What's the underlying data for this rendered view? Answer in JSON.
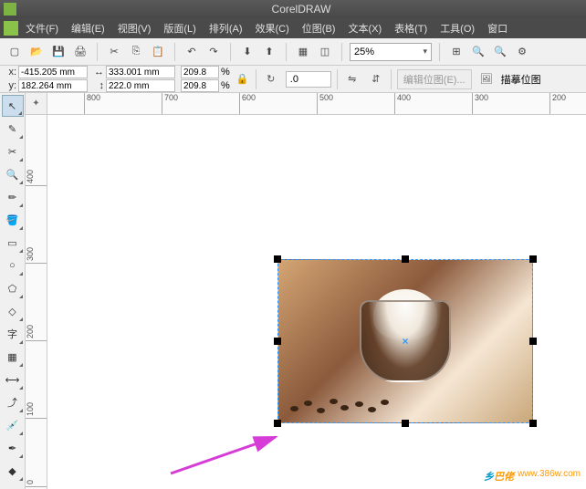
{
  "app": {
    "title": "CorelDRAW"
  },
  "menu": {
    "file": "文件(F)",
    "edit": "编辑(E)",
    "view": "视图(V)",
    "layout": "版面(L)",
    "arrange": "排列(A)",
    "effects": "效果(C)",
    "bitmaps": "位图(B)",
    "text": "文本(X)",
    "table": "表格(T)",
    "tools": "工具(O)",
    "window": "窗口"
  },
  "toolbar": {
    "zoom": "25%"
  },
  "propbar": {
    "x_label": "x:",
    "y_label": "y:",
    "x_value": "-415.205 mm",
    "y_value": "182.264 mm",
    "w_value": "333.001 mm",
    "h_value": "222.0 mm",
    "scale_x": "209.8",
    "scale_y": "209.8",
    "pct": "%",
    "angle": ".0",
    "edit_bitmap": "编辑位图(E)...",
    "trace_bitmap": "描摹位图"
  },
  "ruler_h": {
    "t800": "800",
    "t700": "700",
    "t600": "600",
    "t500": "500",
    "t400": "400",
    "t300": "300",
    "t200": "200"
  },
  "ruler_v": {
    "t400": "400",
    "t300": "300",
    "t200": "200",
    "t100": "100",
    "t0": "0"
  },
  "watermark": {
    "text1": "乡",
    "text2": "巴佬",
    "url": "www.386w.com"
  }
}
